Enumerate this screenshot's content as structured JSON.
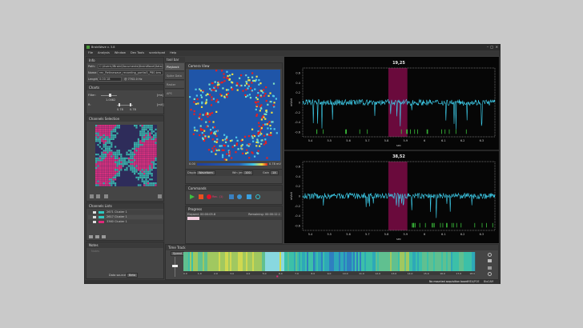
{
  "app": {
    "title": "BrainWave v. 3.8"
  },
  "menu": [
    "File",
    "Analysis",
    "Window",
    "Dev Tools",
    "scratchpad",
    "Help"
  ],
  "info": {
    "title": "Info",
    "path_label": "Path:",
    "path": "C:\\Users\\3Brain\\Documents\\BrainWave\\Data\\recordings",
    "name_label": "Name:",
    "name": "rec_Retinawave_recording_partial1_P80.brw",
    "length_label": "Length:",
    "length": "0:00:18",
    "rate": "@ 7702.0 Hz"
  },
  "charts": {
    "title": "Charts",
    "filter_label": "Filter:",
    "filter_value": "1.0082",
    "filter_unit": "[ms]",
    "range_label": "R:",
    "range_min": "0.78",
    "range_max": "0.78",
    "range_unit": "[mV]"
  },
  "channels_selection": {
    "title": "Channels Selection"
  },
  "channels_lists": {
    "title": "Channels Lists",
    "items": [
      {
        "count": "2671",
        "name": "Cluster 1",
        "color": "#2ec9c0"
      },
      {
        "count": "2617",
        "name": "Cluster 1",
        "color": "#2ec9c0"
      },
      {
        "count": "3360",
        "name": "Cluster 1",
        "color": "#e0287a"
      }
    ]
  },
  "notes": {
    "title": "Notes",
    "placeholder": "Notes",
    "data_source_label": "Data source",
    "data_source_value": "Beta"
  },
  "side_tabs": {
    "header": "tool bar",
    "items": [
      "Playback",
      "Spike Data",
      "Raster",
      "APS"
    ]
  },
  "camera": {
    "title": "Camera View",
    "scale_min": "0.00",
    "scale_max": "0.78 mV",
    "display_label": "Display",
    "display_value": "Waveform",
    "win_label": "Win (ms)",
    "win_value": "100",
    "gain_label": "Gain",
    "gain_value": "1X"
  },
  "commands": {
    "title": "Commands",
    "rec_label": "Rec. (1)"
  },
  "progress": {
    "title": "Progress",
    "elapsed": "Elapsed: 00:00:05.8",
    "remaining": "Remaining: 00:00:12.1",
    "value": 0.32
  },
  "plots": [
    {
      "title": "19,25",
      "ylabel": "mVolt",
      "xlabel": "sec"
    },
    {
      "title": "38,52",
      "ylabel": "mVolt",
      "xlabel": "sec"
    }
  ],
  "plot_axes": {
    "y_ticks": [
      "0.6",
      "0.4",
      "0.2",
      "0",
      "-0.2",
      "-0.4",
      "-0.6"
    ],
    "x_ticks": [
      "5.4",
      "5.5",
      "5.6",
      "5.7",
      "5.8",
      "5.9",
      "6",
      "6.1",
      "6.2",
      "6.3"
    ],
    "highlight": [
      5.81,
      5.91
    ],
    "xlim": [
      5.36,
      6.37
    ],
    "ylim": [
      -0.7,
      0.7
    ]
  },
  "time_track": {
    "title": "Time Track",
    "speed_label": "Speed",
    "ticks": [
      "0.0",
      "1.0",
      "2.0",
      "3.0",
      "4.0",
      "5.0",
      "6.0",
      "7.0",
      "8.0",
      "9.0",
      "10.0",
      "11.0",
      "12.0",
      "13.0",
      "14.0",
      "15.0",
      "16.0",
      "17.0",
      "18.0"
    ],
    "cursor_sec": 5.8
  },
  "status": {
    "message": "No mounted acquisition board",
    "items": [
      "MEA/POE",
      "BioCAM"
    ]
  },
  "colors": {
    "accent": "#e0287a",
    "trace": "#3fd2f0",
    "spike": "#3bbf3b",
    "highlight": "#6a0a3c"
  }
}
